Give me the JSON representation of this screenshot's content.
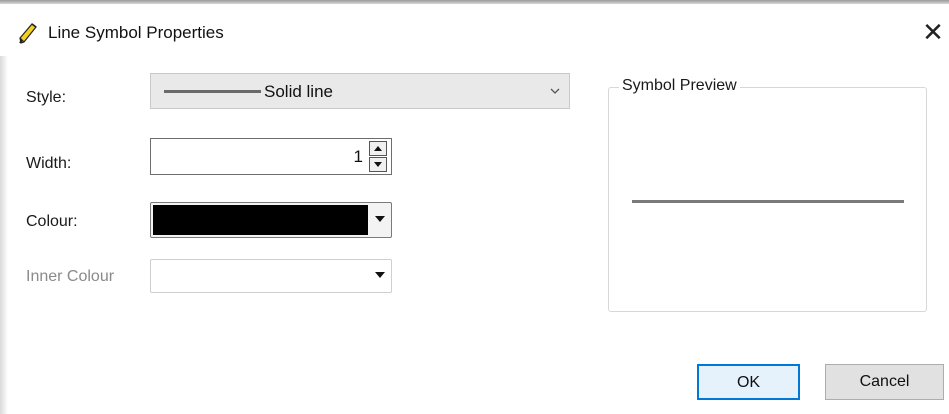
{
  "dialog": {
    "title": "Line Symbol Properties",
    "close_glyph": "✕",
    "icon": "pencil-icon"
  },
  "fields": {
    "style": {
      "label": "Style:",
      "selected_text": "Solid line",
      "icon": "chevron-down-icon"
    },
    "width": {
      "label": "Width:",
      "value": "1"
    },
    "colour": {
      "label": "Colour:",
      "value_color": "#000000"
    },
    "inner_colour": {
      "label": "Inner Colour",
      "enabled": false
    }
  },
  "preview": {
    "legend": "Symbol Preview",
    "line_color": "#7a7a7a"
  },
  "buttons": {
    "ok": "OK",
    "cancel": "Cancel"
  },
  "colors": {
    "accent": "#0078d7",
    "ok_background": "#e5f1fb"
  }
}
